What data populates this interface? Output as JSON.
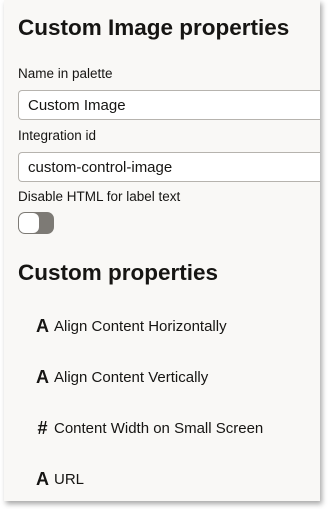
{
  "panel": {
    "title": "Custom Image properties",
    "name_label": "Name in palette",
    "name_value": "Custom Image",
    "id_label": "Integration id",
    "id_value": "custom-control-image",
    "disable_html_label": "Disable HTML for label text",
    "disable_html_enabled": false,
    "section_title": "Custom properties",
    "properties": [
      {
        "icon": "text-type-icon",
        "glyph": "A",
        "label": "Align Content Horizontally"
      },
      {
        "icon": "text-type-icon",
        "glyph": "A",
        "label": "Align Content Vertically"
      },
      {
        "icon": "number-type-icon",
        "glyph": "#",
        "label": "Content Width on Small Screen"
      },
      {
        "icon": "text-type-icon",
        "glyph": "A",
        "label": "URL"
      }
    ]
  }
}
